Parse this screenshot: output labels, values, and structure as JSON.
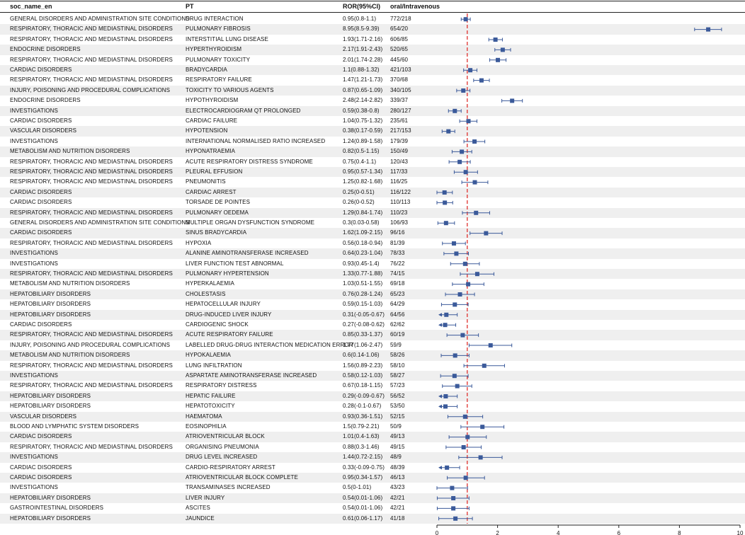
{
  "columns": {
    "soc": "soc_name_en",
    "pt": "PT",
    "ror": "ROR(95%CI)",
    "counts": "oral/Intravenous"
  },
  "rows": [
    {
      "soc": "GENERAL DISORDERS AND ADMINISTRATION SITE CONDITIONS",
      "pt": "DRUG INTERACTION",
      "ror_text": "0.95(0.8-1.1)",
      "counts": "772/218"
    },
    {
      "soc": "RESPIRATORY, THORACIC AND MEDIASTINAL DISORDERS",
      "pt": "PULMONARY FIBROSIS",
      "ror_text": "8.95(8.5-9.39)",
      "counts": "654/20"
    },
    {
      "soc": "RESPIRATORY, THORACIC AND MEDIASTINAL DISORDERS",
      "pt": "INTERSTITIAL LUNG DISEASE",
      "ror_text": "1.93(1.71-2.16)",
      "counts": "606/85"
    },
    {
      "soc": "ENDOCRINE DISORDERS",
      "pt": "HYPERTHYROIDISM",
      "ror_text": "2.17(1.91-2.43)",
      "counts": "520/65"
    },
    {
      "soc": "RESPIRATORY, THORACIC AND MEDIASTINAL DISORDERS",
      "pt": "PULMONARY TOXICITY",
      "ror_text": "2.01(1.74-2.28)",
      "counts": "445/60"
    },
    {
      "soc": "CARDIAC DISORDERS",
      "pt": "BRADYCARDIA",
      "ror_text": "1.1(0.88-1.32)",
      "counts": "421/103"
    },
    {
      "soc": "RESPIRATORY, THORACIC AND MEDIASTINAL DISORDERS",
      "pt": "RESPIRATORY FAILURE",
      "ror_text": "1.47(1.21-1.73)",
      "counts": "370/68"
    },
    {
      "soc": "INJURY, POISONING AND PROCEDURAL COMPLICATIONS",
      "pt": "TOXICITY TO VARIOUS AGENTS",
      "ror_text": "0.87(0.65-1.09)",
      "counts": "340/105"
    },
    {
      "soc": "ENDOCRINE DISORDERS",
      "pt": "HYPOTHYROIDISM",
      "ror_text": "2.48(2.14-2.82)",
      "counts": "339/37"
    },
    {
      "soc": "INVESTIGATIONS",
      "pt": "ELECTROCARDIOGRAM QT PROLONGED",
      "ror_text": "0.59(0.38-0.8)",
      "counts": "280/127"
    },
    {
      "soc": "CARDIAC DISORDERS",
      "pt": "CARDIAC FAILURE",
      "ror_text": "1.04(0.75-1.32)",
      "counts": "235/61"
    },
    {
      "soc": "VASCULAR DISORDERS",
      "pt": "HYPOTENSION",
      "ror_text": "0.38(0.17-0.59)",
      "counts": "217/153"
    },
    {
      "soc": "INVESTIGATIONS",
      "pt": "INTERNATIONAL NORMALISED RATIO INCREASED",
      "ror_text": "1.24(0.89-1.58)",
      "counts": "179/39"
    },
    {
      "soc": "METABOLISM AND NUTRITION DISORDERS",
      "pt": "HYPONATRAEMIA",
      "ror_text": "0.82(0.5-1.15)",
      "counts": "150/49"
    },
    {
      "soc": "RESPIRATORY, THORACIC AND MEDIASTINAL DISORDERS",
      "pt": "ACUTE RESPIRATORY DISTRESS SYNDROME",
      "ror_text": "0.75(0.4-1.1)",
      "counts": "120/43"
    },
    {
      "soc": "RESPIRATORY, THORACIC AND MEDIASTINAL DISORDERS",
      "pt": "PLEURAL EFFUSION",
      "ror_text": "0.95(0.57-1.34)",
      "counts": "117/33"
    },
    {
      "soc": "RESPIRATORY, THORACIC AND MEDIASTINAL DISORDERS",
      "pt": "PNEUMONITIS",
      "ror_text": "1.25(0.82-1.68)",
      "counts": "116/25"
    },
    {
      "soc": "CARDIAC DISORDERS",
      "pt": "CARDIAC ARREST",
      "ror_text": "0.25(0-0.51)",
      "counts": "116/122"
    },
    {
      "soc": "CARDIAC DISORDERS",
      "pt": "TORSADE DE POINTES",
      "ror_text": "0.26(0-0.52)",
      "counts": "110/113"
    },
    {
      "soc": "RESPIRATORY, THORACIC AND MEDIASTINAL DISORDERS",
      "pt": "PULMONARY OEDEMA",
      "ror_text": "1.29(0.84-1.74)",
      "counts": "110/23"
    },
    {
      "soc": "GENERAL DISORDERS AND ADMINISTRATION SITE CONDITIONS",
      "pt": "MULTIPLE ORGAN DYSFUNCTION SYNDROME",
      "ror_text": "0.3(0.03-0.58)",
      "counts": "106/93"
    },
    {
      "soc": "CARDIAC DISORDERS",
      "pt": "SINUS BRADYCARDIA",
      "ror_text": "1.62(1.09-2.15)",
      "counts": "96/16"
    },
    {
      "soc": "RESPIRATORY, THORACIC AND MEDIASTINAL DISORDERS",
      "pt": "HYPOXIA",
      "ror_text": "0.56(0.18-0.94)",
      "counts": "81/39"
    },
    {
      "soc": "INVESTIGATIONS",
      "pt": "ALANINE AMINOTRANSFERASE INCREASED",
      "ror_text": "0.64(0.23-1.04)",
      "counts": "78/33"
    },
    {
      "soc": "INVESTIGATIONS",
      "pt": "LIVER FUNCTION TEST ABNORMAL",
      "ror_text": "0.93(0.45-1.4)",
      "counts": "76/22"
    },
    {
      "soc": "RESPIRATORY, THORACIC AND MEDIASTINAL DISORDERS",
      "pt": "PULMONARY HYPERTENSION",
      "ror_text": "1.33(0.77-1.88)",
      "counts": "74/15"
    },
    {
      "soc": "METABOLISM AND NUTRITION DISORDERS",
      "pt": "HYPERKALAEMIA",
      "ror_text": "1.03(0.51-1.55)",
      "counts": "69/18"
    },
    {
      "soc": "HEPATOBILIARY DISORDERS",
      "pt": "CHOLESTASIS",
      "ror_text": "0.76(0.28-1.24)",
      "counts": "65/23"
    },
    {
      "soc": "HEPATOBILIARY DISORDERS",
      "pt": "HEPATOCELLULAR INJURY",
      "ror_text": "0.59(0.15-1.03)",
      "counts": "64/29"
    },
    {
      "soc": "HEPATOBILIARY DISORDERS",
      "pt": "DRUG-INDUCED LIVER INJURY",
      "ror_text": "0.31(-0.05-0.67)",
      "counts": "64/56"
    },
    {
      "soc": "CARDIAC DISORDERS",
      "pt": "CARDIOGENIC SHOCK",
      "ror_text": "0.27(-0.08-0.62)",
      "counts": "62/62"
    },
    {
      "soc": "RESPIRATORY, THORACIC AND MEDIASTINAL DISORDERS",
      "pt": "ACUTE RESPIRATORY FAILURE",
      "ror_text": "0.85(0.33-1.37)",
      "counts": "60/19"
    },
    {
      "soc": "INJURY, POISONING AND PROCEDURAL COMPLICATIONS",
      "pt": "LABELLED DRUG-DRUG INTERACTION MEDICATION ERROR",
      "ror_text": "1.77(1.06-2.47)",
      "counts": "59/9"
    },
    {
      "soc": "METABOLISM AND NUTRITION DISORDERS",
      "pt": "HYPOKALAEMIA",
      "ror_text": "0.6(0.14-1.06)",
      "counts": "58/26"
    },
    {
      "soc": "RESPIRATORY, THORACIC AND MEDIASTINAL DISORDERS",
      "pt": "LUNG INFILTRATION",
      "ror_text": "1.56(0.89-2.23)",
      "counts": "58/10"
    },
    {
      "soc": "INVESTIGATIONS",
      "pt": "ASPARTATE AMINOTRANSFERASE INCREASED",
      "ror_text": "0.58(0.12-1.03)",
      "counts": "58/27"
    },
    {
      "soc": "RESPIRATORY, THORACIC AND MEDIASTINAL DISORDERS",
      "pt": "RESPIRATORY DISTRESS",
      "ror_text": "0.67(0.18-1.15)",
      "counts": "57/23"
    },
    {
      "soc": "HEPATOBILIARY DISORDERS",
      "pt": "HEPATIC FAILURE",
      "ror_text": "0.29(-0.09-0.67)",
      "counts": "56/52"
    },
    {
      "soc": "HEPATOBILIARY DISORDERS",
      "pt": "HEPATOTOXICITY",
      "ror_text": "0.28(-0.1-0.67)",
      "counts": "53/50"
    },
    {
      "soc": "VASCULAR DISORDERS",
      "pt": "HAEMATOMA",
      "ror_text": "0.93(0.36-1.51)",
      "counts": "52/15"
    },
    {
      "soc": "BLOOD AND LYMPHATIC SYSTEM DISORDERS",
      "pt": "EOSINOPHILIA",
      "ror_text": "1.5(0.79-2.21)",
      "counts": "50/9"
    },
    {
      "soc": "CARDIAC DISORDERS",
      "pt": "ATRIOVENTRICULAR BLOCK",
      "ror_text": "1.01(0.4-1.63)",
      "counts": "49/13"
    },
    {
      "soc": "RESPIRATORY, THORACIC AND MEDIASTINAL DISORDERS",
      "pt": "ORGANISING PNEUMONIA",
      "ror_text": "0.88(0.3-1.46)",
      "counts": "49/15"
    },
    {
      "soc": "INVESTIGATIONS",
      "pt": "DRUG LEVEL INCREASED",
      "ror_text": "1.44(0.72-2.15)",
      "counts": "48/9"
    },
    {
      "soc": "CARDIAC DISORDERS",
      "pt": "CARDIO-RESPIRATORY ARREST",
      "ror_text": "0.33(-0.09-0.75)",
      "counts": "48/39"
    },
    {
      "soc": "CARDIAC DISORDERS",
      "pt": "ATRIOVENTRICULAR BLOCK COMPLETE",
      "ror_text": "0.95(0.34-1.57)",
      "counts": "46/13"
    },
    {
      "soc": "INVESTIGATIONS",
      "pt": "TRANSAMINASES INCREASED",
      "ror_text": "0.5(0-1.01)",
      "counts": "43/23"
    },
    {
      "soc": "HEPATOBILIARY DISORDERS",
      "pt": "LIVER INJURY",
      "ror_text": "0.54(0.01-1.06)",
      "counts": "42/21"
    },
    {
      "soc": "GASTROINTESTINAL DISORDERS",
      "pt": "ASCITES",
      "ror_text": "0.54(0.01-1.06)",
      "counts": "42/21"
    },
    {
      "soc": "HEPATOBILIARY DISORDERS",
      "pt": "JAUNDICE",
      "ror_text": "0.61(0.06-1.17)",
      "counts": "41/18"
    }
  ],
  "chart_data": {
    "type": "scatter",
    "subtype": "forest-plot",
    "title": "",
    "xlabel": "",
    "ylabel": "",
    "xlim": [
      0,
      10
    ],
    "xticks": [
      "0",
      "2",
      "4",
      "6",
      "8",
      "10"
    ],
    "reference_line": 1,
    "grid": false,
    "colors": {
      "marker": "#3b5a9a",
      "reference": "#e0302e",
      "row_shade": "#efefef"
    },
    "categories": [
      "DRUG INTERACTION",
      "PULMONARY FIBROSIS",
      "INTERSTITIAL LUNG DISEASE",
      "HYPERTHYROIDISM",
      "PULMONARY TOXICITY",
      "BRADYCARDIA",
      "RESPIRATORY FAILURE",
      "TOXICITY TO VARIOUS AGENTS",
      "HYPOTHYROIDISM",
      "ELECTROCARDIOGRAM QT PROLONGED",
      "CARDIAC FAILURE",
      "HYPOTENSION",
      "INTERNATIONAL NORMALISED RATIO INCREASED",
      "HYPONATRAEMIA",
      "ACUTE RESPIRATORY DISTRESS SYNDROME",
      "PLEURAL EFFUSION",
      "PNEUMONITIS",
      "CARDIAC ARREST",
      "TORSADE DE POINTES",
      "PULMONARY OEDEMA",
      "MULTIPLE ORGAN DYSFUNCTION SYNDROME",
      "SINUS BRADYCARDIA",
      "HYPOXIA",
      "ALANINE AMINOTRANSFERASE INCREASED",
      "LIVER FUNCTION TEST ABNORMAL",
      "PULMONARY HYPERTENSION",
      "HYPERKALAEMIA",
      "CHOLESTASIS",
      "HEPATOCELLULAR INJURY",
      "DRUG-INDUCED LIVER INJURY",
      "CARDIOGENIC SHOCK",
      "ACUTE RESPIRATORY FAILURE",
      "LABELLED DRUG-DRUG INTERACTION MEDICATION ERROR",
      "HYPOKALAEMIA",
      "LUNG INFILTRATION",
      "ASPARTATE AMINOTRANSFERASE INCREASED",
      "RESPIRATORY DISTRESS",
      "HEPATIC FAILURE",
      "HEPATOTOXICITY",
      "HAEMATOMA",
      "EOSINOPHILIA",
      "ATRIOVENTRICULAR BLOCK",
      "ORGANISING PNEUMONIA",
      "DRUG LEVEL INCREASED",
      "CARDIO-RESPIRATORY ARREST",
      "ATRIOVENTRICULAR BLOCK COMPLETE",
      "TRANSAMINASES INCREASED",
      "LIVER INJURY",
      "ASCITES",
      "JAUNDICE"
    ],
    "ror": [
      0.95,
      8.95,
      1.93,
      2.17,
      2.01,
      1.1,
      1.47,
      0.87,
      2.48,
      0.59,
      1.04,
      0.38,
      1.24,
      0.82,
      0.75,
      0.95,
      1.25,
      0.25,
      0.26,
      1.29,
      0.3,
      1.62,
      0.56,
      0.64,
      0.93,
      1.33,
      1.03,
      0.76,
      0.59,
      0.31,
      0.27,
      0.85,
      1.77,
      0.6,
      1.56,
      0.58,
      0.67,
      0.29,
      0.28,
      0.93,
      1.5,
      1.01,
      0.88,
      1.44,
      0.33,
      0.95,
      0.5,
      0.54,
      0.54,
      0.61
    ],
    "lower": [
      0.8,
      8.5,
      1.71,
      1.91,
      1.74,
      0.88,
      1.21,
      0.65,
      2.14,
      0.38,
      0.75,
      0.17,
      0.89,
      0.5,
      0.4,
      0.57,
      0.82,
      0,
      0,
      0.84,
      0.03,
      1.09,
      0.18,
      0.23,
      0.45,
      0.77,
      0.51,
      0.28,
      0.15,
      -0.05,
      -0.08,
      0.33,
      1.06,
      0.14,
      0.89,
      0.12,
      0.18,
      -0.09,
      -0.1,
      0.36,
      0.79,
      0.4,
      0.3,
      0.72,
      -0.09,
      0.34,
      0,
      0.01,
      0.01,
      0.06
    ],
    "upper": [
      1.1,
      9.39,
      2.16,
      2.43,
      2.28,
      1.32,
      1.73,
      1.09,
      2.82,
      0.8,
      1.32,
      0.59,
      1.58,
      1.15,
      1.1,
      1.34,
      1.68,
      0.51,
      0.52,
      1.74,
      0.58,
      2.15,
      0.94,
      1.04,
      1.4,
      1.88,
      1.55,
      1.24,
      1.03,
      0.67,
      0.62,
      1.37,
      2.47,
      1.06,
      2.23,
      1.03,
      1.15,
      0.67,
      0.67,
      1.51,
      2.21,
      1.63,
      1.46,
      2.15,
      0.75,
      1.57,
      1.01,
      1.06,
      1.06,
      1.17
    ]
  }
}
